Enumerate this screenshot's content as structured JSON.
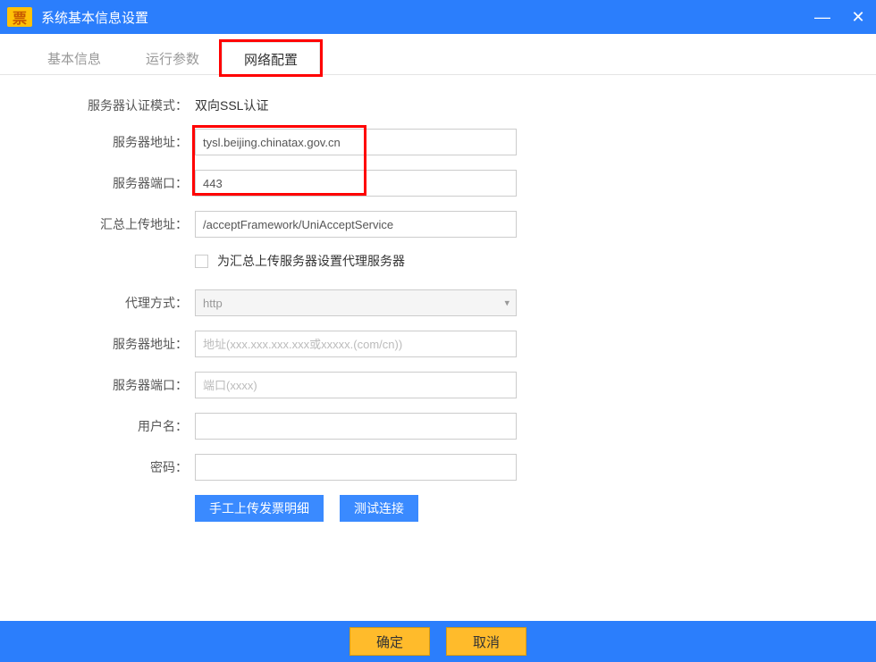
{
  "window": {
    "app_icon_text": "票",
    "title": "系统基本信息设置"
  },
  "tabs": [
    {
      "label": "基本信息"
    },
    {
      "label": "运行参数"
    },
    {
      "label": "网络配置"
    }
  ],
  "form": {
    "auth_mode_label": "服务器认证模式：",
    "auth_mode_value": "双向SSL认证",
    "server_addr_label": "服务器地址：",
    "server_addr_value": "tysl.beijing.chinatax.gov.cn",
    "server_port_label": "服务器端口：",
    "server_port_value": "443",
    "upload_addr_label": "汇总上传地址：",
    "upload_addr_value": "/acceptFramework/UniAcceptService",
    "proxy_checkbox_label": "为汇总上传服务器设置代理服务器",
    "proxy_method_label": "代理方式：",
    "proxy_method_value": "http",
    "proxy_addr_label": "服务器地址：",
    "proxy_addr_placeholder": "地址(xxx.xxx.xxx.xxx或xxxxx.(com/cn))",
    "proxy_port_label": "服务器端口：",
    "proxy_port_placeholder": "端口(xxxx)",
    "username_label": "用户名：",
    "password_label": "密码："
  },
  "buttons": {
    "manual_upload": "手工上传发票明细",
    "test_connection": "测试连接",
    "ok": "确定",
    "cancel": "取消"
  }
}
